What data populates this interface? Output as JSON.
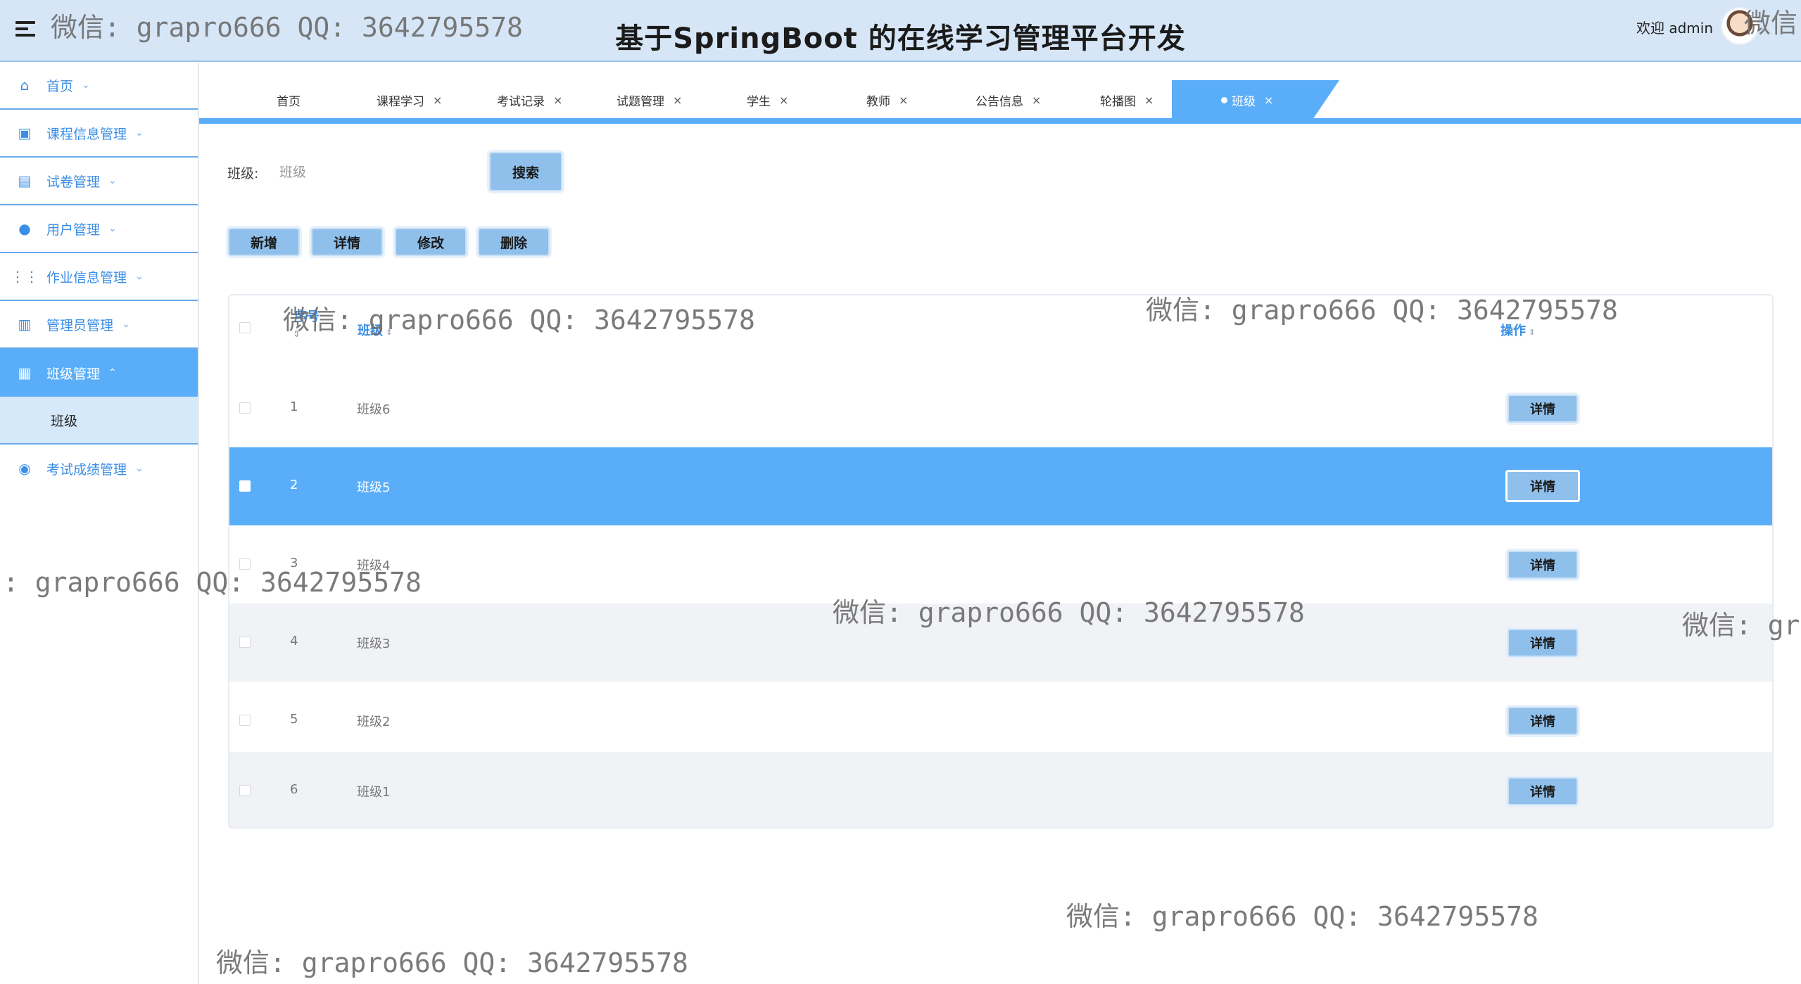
{
  "header": {
    "title": "基于SpringBoot 的在线学习管理平台开发",
    "welcome": "欢迎 admin",
    "menu_icon": "hamburger-menu-icon",
    "avatar_icon": "user-avatar"
  },
  "sidebar": {
    "items": [
      {
        "label": "首页",
        "icon": "home-icon",
        "chevron": "⌄"
      },
      {
        "label": "课程信息管理",
        "icon": "course-icon",
        "chevron": "⌄"
      },
      {
        "label": "试卷管理",
        "icon": "exam-paper-icon",
        "chevron": "⌄"
      },
      {
        "label": "用户管理",
        "icon": "user-icon",
        "chevron": "⌄"
      },
      {
        "label": "作业信息管理",
        "icon": "grid-icon",
        "chevron": "⌄"
      },
      {
        "label": "管理员管理",
        "icon": "table-icon",
        "chevron": "⌄"
      },
      {
        "label": "班级管理",
        "icon": "class-icon",
        "chevron": "⌃"
      },
      {
        "label": "考试成绩管理",
        "icon": "score-icon",
        "chevron": "⌄"
      }
    ],
    "subitem": "班级"
  },
  "tabs": [
    {
      "label": "首页",
      "close": ""
    },
    {
      "label": "课程学习",
      "close": "×"
    },
    {
      "label": "考试记录",
      "close": "×"
    },
    {
      "label": "试题管理",
      "close": "×"
    },
    {
      "label": "学生",
      "close": "×"
    },
    {
      "label": "教师",
      "close": "×"
    },
    {
      "label": "公告信息",
      "close": "×"
    },
    {
      "label": "轮播图",
      "close": "×"
    },
    {
      "label": "班级",
      "close": "×"
    }
  ],
  "search": {
    "label": "班级:",
    "placeholder": "班级",
    "button": "搜索"
  },
  "actions": {
    "add": "新增",
    "detail": "详情",
    "edit": "修改",
    "delete": "删除"
  },
  "table": {
    "headers": {
      "index": "序号",
      "class": "班级",
      "ops": "操作"
    },
    "detail_label": "详情",
    "rows": [
      {
        "index": "1",
        "class": "班级6"
      },
      {
        "index": "2",
        "class": "班级5"
      },
      {
        "index": "3",
        "class": "班级4"
      },
      {
        "index": "4",
        "class": "班级3"
      },
      {
        "index": "5",
        "class": "班级2"
      },
      {
        "index": "6",
        "class": "班级1"
      }
    ],
    "selected_row": 2
  },
  "watermark": {
    "text": "微信: grapro666 QQ: 3642795578",
    "text_cut_left": ": grapro666 QQ: 3642795578",
    "text_cut_right": "微信: gr",
    "text_cut_corner": "微信"
  },
  "colors": {
    "accent": "#5aaef9",
    "header_bg": "#d6e6f7",
    "button_bg": "#8fc0ec"
  }
}
